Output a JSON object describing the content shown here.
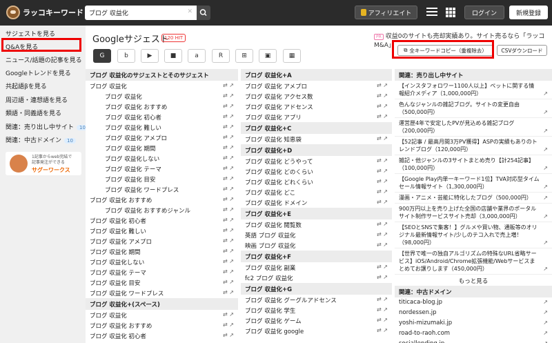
{
  "header": {
    "logo": "ラッコキーワード",
    "search_value": "ブログ 収益化",
    "affiliate": "アフィリエイト",
    "login": "ログイン",
    "signup": "新規登録"
  },
  "sidebar": {
    "items": [
      {
        "label": "サジェストを見る"
      },
      {
        "label": "Q&Aを見る"
      },
      {
        "label": "ニュース/話題の記事を見る"
      },
      {
        "label": "Googleトレンドを見る"
      },
      {
        "label": "共起語βを見る"
      },
      {
        "label": "周辺語・連想語を見る"
      },
      {
        "label": "類語・同義語を見る"
      },
      {
        "label": "関連：売り出し中サイト",
        "badge": "10"
      },
      {
        "label": "関連：中古ドメイン",
        "badge": "10"
      }
    ],
    "ad": {
      "line1": "1記事からweb完結で",
      "line2": "記事発注ができる",
      "brand": "サグーワークス"
    }
  },
  "main": {
    "title": "Googleサジェスト",
    "hit": "120 HIT",
    "pr_tag": "PR",
    "pr_text": "収益0のサイトも売却実績あり。サイト売るなら「ラッコM&A」",
    "copy_btn": "全キーワードコピー（重複除去）",
    "csv_btn": "CSVダウンロード",
    "source_icons": [
      "G",
      "b",
      "▶",
      "■",
      "a",
      "R",
      "⊞",
      "▣",
      "▦"
    ]
  },
  "col1": {
    "header": "ブログ 収益化のサジェストとそのサジェスト",
    "rows": [
      {
        "t": "ブログ 収益化",
        "i": 0
      },
      {
        "t": "ブログ 収益化",
        "i": 1
      },
      {
        "t": "ブログ 収益化 おすすめ",
        "i": 1
      },
      {
        "t": "ブログ 収益化 初心者",
        "i": 1
      },
      {
        "t": "ブログ 収益化 難しい",
        "i": 1
      },
      {
        "t": "ブログ 収益化 アメプロ",
        "i": 1
      },
      {
        "t": "ブログ 収益化 期間",
        "i": 1
      },
      {
        "t": "ブログ 収益化しない",
        "i": 1
      },
      {
        "t": "ブログ 収益化 テーマ",
        "i": 1
      },
      {
        "t": "ブログ 収益化 目安",
        "i": 1
      },
      {
        "t": "ブログ 収益化 ワードプレス",
        "i": 1
      },
      {
        "t": "ブログ 収益化 おすすめ",
        "i": 0
      },
      {
        "t": "ブログ 収益化 おすすめジャンル",
        "i": 1
      },
      {
        "t": "ブログ 収益化 初心者",
        "i": 0
      },
      {
        "t": "ブログ 収益化 難しい",
        "i": 0
      },
      {
        "t": "ブログ 収益化 アメプロ",
        "i": 0
      },
      {
        "t": "ブログ 収益化 期間",
        "i": 0
      },
      {
        "t": "ブログ 収益化しない",
        "i": 0
      },
      {
        "t": "ブログ 収益化 テーマ",
        "i": 0
      },
      {
        "t": "ブログ 収益化 目安",
        "i": 0
      },
      {
        "t": "ブログ 収益化 ワードプレス",
        "i": 0
      }
    ],
    "header2": "ブログ 収益化+(スペース)",
    "rows2": [
      {
        "t": "ブログ 収益化",
        "i": 0
      },
      {
        "t": "ブログ 収益化 おすすめ",
        "i": 0
      },
      {
        "t": "ブログ 収益化 初心者",
        "i": 0
      }
    ]
  },
  "col2": {
    "groups": [
      {
        "h": "ブログ 収益化+A",
        "rows": [
          "ブログ 収益化 アメプロ",
          "ブログ 収益化 アクセス数",
          "ブログ 収益化 アドセンス",
          "ブログ 収益化 アプリ"
        ]
      },
      {
        "h": "ブログ 収益化+C",
        "rows": [
          "ブログ 収益化 知恵袋"
        ]
      },
      {
        "h": "ブログ 収益化+D",
        "rows": [
          "ブログ 収益化 どうやって",
          "ブログ 収益化 どのくらい",
          "ブログ 収益化 どれくらい",
          "ブログ 収益化 どこ",
          "ブログ 収益化 ドメイン"
        ]
      },
      {
        "h": "ブログ 収益化+E",
        "rows": [
          "ブログ 収益化 閲覧数",
          "英語 ブログ 収益化",
          "映画 ブログ 収益化"
        ]
      },
      {
        "h": "ブログ 収益化+F",
        "rows": [
          "ブログ 収益化 副業",
          "fc2 ブログ 収益化"
        ]
      },
      {
        "h": "ブログ 収益化+G",
        "rows": [
          "ブログ 収益化 グーグルアドセンス",
          "ブログ 収益化 学生",
          "ブログ 収益化 ゲーム",
          "ブログ 収益化 google"
        ]
      }
    ]
  },
  "col3": {
    "header": "関連：売り出し中サイト",
    "sales": [
      "【インスタフォロワー1100人以上】ペットに関する情報紹介メディア（1,000,000円）",
      "色んなジャンルの雑記ブログ。サイトの変更自由（500,000円）",
      "運営歴4年で安定したPVが見込める雑記ブログ（200,000円）",
      "【52記事 / 最高月間3万PV獲得】ASPの実績もありのトレンドブログ（120,000円）",
      "雑記・他ジャンルの3サイトまとめ売り【計254記事】（100,000円）",
      "【Google Play内単一キーワード1位】TVA対応型タイムセール情報サイト（1,300,000円）",
      "漫画・アニメ・芸能に特化したブログ（500,000円）",
      "900万円以上を売り上げた全国の店舗や業界のポータルサイト制作サービスサイト売却（3,000,000円）",
      "【SEOとSNSで集客！】グルメや買い物、通販等のオリジナル最新情報サイト/少しのテコ入れで売上増！（98,000円）",
      "【世界で唯一の独自アルゴリズムの特殊なURL省略サービス】iOS/Android/Chrome拡張機能/Webサービスまとめてお譲りします（450,000円）"
    ],
    "more": "もっと見る",
    "header2": "関連：中古ドメイン",
    "domains": [
      "titicaca-blog.jp",
      "nordessen.jp",
      "yoshi-mizumaki.jp",
      "road-to-raoh.com",
      "sociallending.jp",
      "shibatamasaharu.com"
    ]
  }
}
